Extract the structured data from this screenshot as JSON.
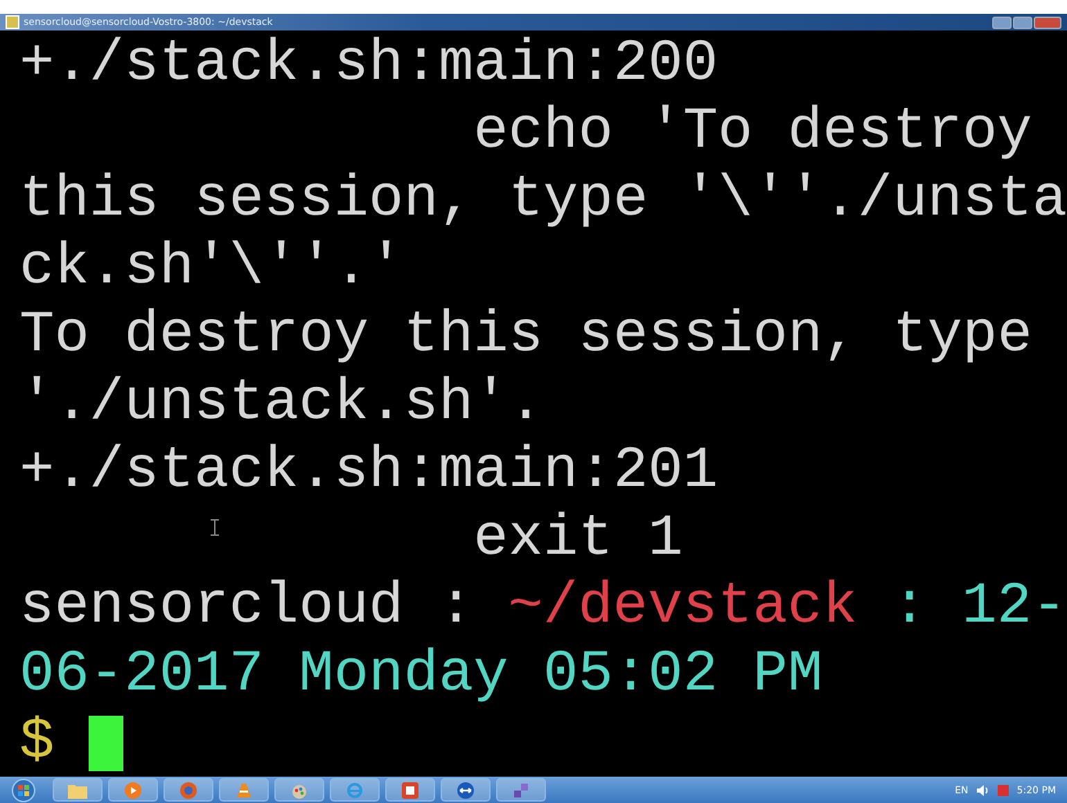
{
  "window": {
    "title": "sensorcloud@sensorcloud-Vostro-3800: ~/devstack"
  },
  "terminal": {
    "lines": [
      {
        "segments": [
          {
            "text": "+./stack.sh:main:200",
            "color": "#d6d6d6"
          }
        ]
      },
      {
        "segments": [
          {
            "text": "echo 'To destroy",
            "color": "#d6d6d6"
          }
        ],
        "indented": true
      },
      {
        "segments": [
          {
            "text": "this session, type '\\''./unsta",
            "color": "#d6d6d6"
          }
        ]
      },
      {
        "segments": [
          {
            "text": "ck.sh'\\''.'",
            "color": "#d6d6d6"
          }
        ]
      },
      {
        "segments": [
          {
            "text": "To destroy this session, type",
            "color": "#d6d6d6"
          }
        ]
      },
      {
        "segments": [
          {
            "text": "'./unstack.sh'.",
            "color": "#d6d6d6"
          }
        ]
      },
      {
        "segments": [
          {
            "text": "+./stack.sh:main:201",
            "color": "#d6d6d6"
          }
        ]
      },
      {
        "segments": [
          {
            "text": "exit 1",
            "color": "#d6d6d6"
          }
        ],
        "indented": true
      },
      {
        "segments": [
          {
            "text": "sensorcloud :",
            "color": "#d6d6d6"
          },
          {
            "text": "~/devstack",
            "color": "#e0404a"
          },
          {
            "text": ": 12-",
            "color": "#52d6c4"
          }
        ]
      },
      {
        "segments": [
          {
            "text": "06-2017 Monday 05:02 PM",
            "color": "#52d6c4"
          }
        ]
      },
      {
        "segments": [
          {
            "text": "$",
            "color": "#d8c63a"
          }
        ],
        "cursor": true
      }
    ]
  },
  "taskbar": {
    "language": "EN",
    "time": "5:20 PM"
  }
}
